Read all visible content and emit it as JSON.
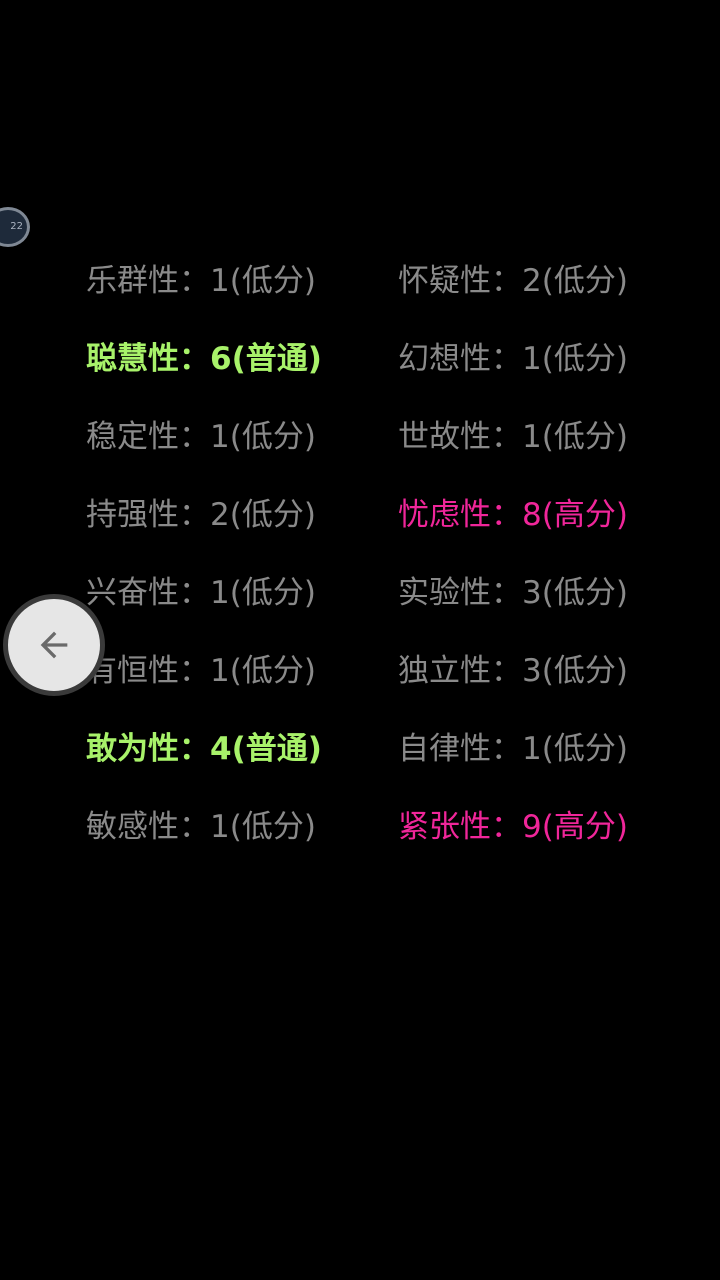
{
  "floating_badge": {
    "label": "22"
  },
  "traits": [
    {
      "text": "乐群性：1(低分)",
      "level": "low"
    },
    {
      "text": "怀疑性：2(低分)",
      "level": "low"
    },
    {
      "text": "聪慧性：6(普通)",
      "level": "normal"
    },
    {
      "text": "幻想性：1(低分)",
      "level": "low"
    },
    {
      "text": "稳定性：1(低分)",
      "level": "low"
    },
    {
      "text": "世故性：1(低分)",
      "level": "low"
    },
    {
      "text": "持强性：2(低分)",
      "level": "low"
    },
    {
      "text": "忧虑性：8(高分)",
      "level": "high"
    },
    {
      "text": "兴奋性：1(低分)",
      "level": "low"
    },
    {
      "text": "实验性：3(低分)",
      "level": "low"
    },
    {
      "text": "有恒性：1(低分)",
      "level": "low"
    },
    {
      "text": "独立性：3(低分)",
      "level": "low"
    },
    {
      "text": "敢为性：4(普通)",
      "level": "normal"
    },
    {
      "text": "自律性：1(低分)",
      "level": "low"
    },
    {
      "text": "敏感性：1(低分)",
      "level": "low"
    },
    {
      "text": "紧张性：9(高分)",
      "level": "high"
    }
  ],
  "colors": {
    "background": "#000000",
    "low": "#8a8a8a",
    "normal": "#a8f26a",
    "high": "#f0269a"
  },
  "icons": {
    "back_button": "arrow-left-icon"
  }
}
